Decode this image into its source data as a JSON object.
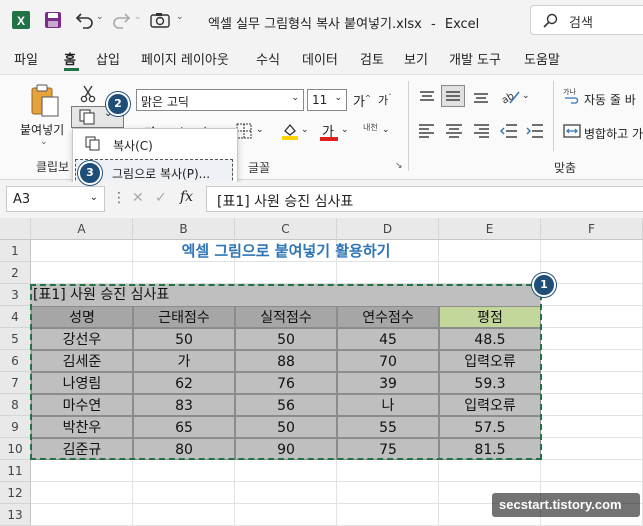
{
  "window": {
    "filename": "엑셀 실무 그림형식 복사 붙여넣기.xlsx",
    "separator": "-",
    "app": "Excel",
    "search_placeholder": "검색"
  },
  "ribbon_tabs": [
    "파일",
    "홈",
    "삽입",
    "페이지 레이아웃",
    "수식",
    "데이터",
    "검토",
    "보기",
    "개발 도구",
    "도움말"
  ],
  "active_tab": "홈",
  "ribbon": {
    "paste_label": "붙여넣기",
    "clipboard_label": "클립보",
    "font_name": "맑은 고딕",
    "font_size": "11",
    "font_group_label": "글꼴",
    "align_group_label": "맞춤",
    "wrap_text": "자동 줄 바",
    "merge_center": "병합하고 가",
    "phonetic_label": "내천"
  },
  "copy_menu": {
    "items": [
      "복사(C)",
      "그림으로 복사(P)..."
    ]
  },
  "badges": [
    "1",
    "2",
    "3"
  ],
  "formula_bar": {
    "name_box": "A3",
    "fx": "fx",
    "content": "[표1] 사원 승진 심사표"
  },
  "sheet": {
    "columns": [
      "A",
      "B",
      "C",
      "D",
      "E",
      "F"
    ],
    "rows": [
      "1",
      "2",
      "3",
      "4",
      "5",
      "6",
      "7",
      "8",
      "9",
      "10",
      "11",
      "12",
      "13"
    ],
    "title": "엑셀 그림으로 붙여넣기 활용하기",
    "table_caption": "[표1] 사원 승진 심사표",
    "headers": [
      "성명",
      "근태점수",
      "실적점수",
      "연수점수",
      "평점"
    ],
    "data": [
      [
        "강선우",
        "50",
        "50",
        "45",
        "48.5"
      ],
      [
        "김세준",
        "가",
        "88",
        "70",
        "입력오류"
      ],
      [
        "나영림",
        "62",
        "76",
        "39",
        "59.3"
      ],
      [
        "마수연",
        "83",
        "56",
        "나",
        "입력오류"
      ],
      [
        "박찬우",
        "65",
        "50",
        "55",
        "57.5"
      ],
      [
        "김준규",
        "80",
        "90",
        "75",
        "81.5"
      ]
    ]
  },
  "watermark": "secstart.tistory.com",
  "colors": {
    "excel_green": "#217346",
    "title_blue": "#2e75b6",
    "header_gray": "#a6a6a6",
    "cell_gray": "#bfbfbf",
    "score_header": "#c4d79b",
    "badge": "#1f4e79"
  }
}
